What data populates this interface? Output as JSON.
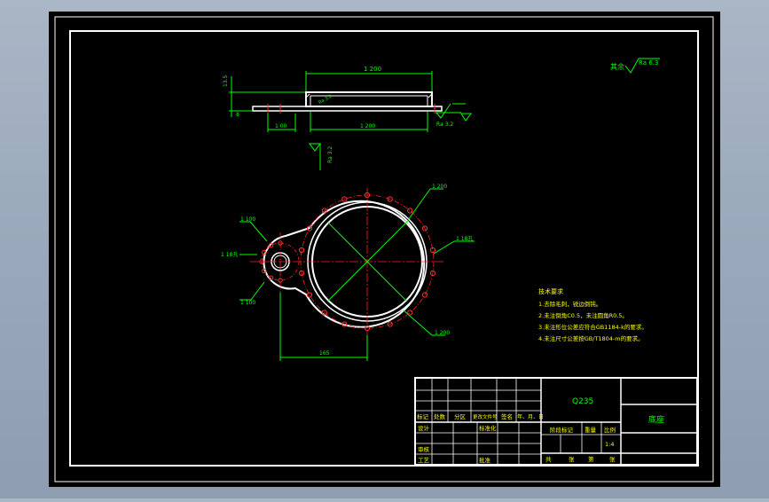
{
  "colors": {
    "background": "#000000",
    "frame": "#ffffff",
    "dimension": "#00ff00",
    "centerline": "#ff2020",
    "hole": "#ff3030",
    "text_yellow": "#ffff00",
    "outside": "#a9b6c6"
  },
  "drawing": {
    "top_view_dims": {
      "overall_width": "1 200",
      "height_left": "13.5",
      "tab_width": "1 00",
      "inner_dia": "1 200",
      "thickness_label": "8",
      "plate_label": "Ra 3.2"
    },
    "roughness": {
      "general_label": "其余",
      "general_value": "Ra 6.3",
      "side_value": "Ra 3.2",
      "bottom_value": "Ra 3.2"
    },
    "plan_view_dims": {
      "outer_dia": "1 200",
      "bolt_circle": "1 180",
      "inner_holes": "1 18孔",
      "small_dia": "1 100",
      "small_holes": "1 18孔",
      "small_bolt": "1 100",
      "bottom_dia": "1 200",
      "offset": "165"
    },
    "notes": {
      "title": "技术要求",
      "items": [
        "1.去除毛刺，锐边倒钝。",
        "2.未注倒角C0.5，未注圆角R0.5。",
        "3.未注形位公差应符合GB1184-k的要求。",
        "4.未注尺寸公差按GB/T1804-m的要求。"
      ]
    }
  },
  "title_block": {
    "material": "Q235",
    "part_name": "底座",
    "header_row": [
      "标记",
      "处数",
      "分区",
      "更改文件号",
      "签名",
      "年、月、日"
    ],
    "design_label": "设计",
    "standard_label": "标准化",
    "stage_label": "阶段标记",
    "weight_label": "重量",
    "scale_label": "比例",
    "scale_value": "1:4",
    "review_label": "审核",
    "process_label": "工艺",
    "approve_label": "批准",
    "sheet_labels": [
      "共",
      "张",
      "第",
      "张"
    ]
  }
}
